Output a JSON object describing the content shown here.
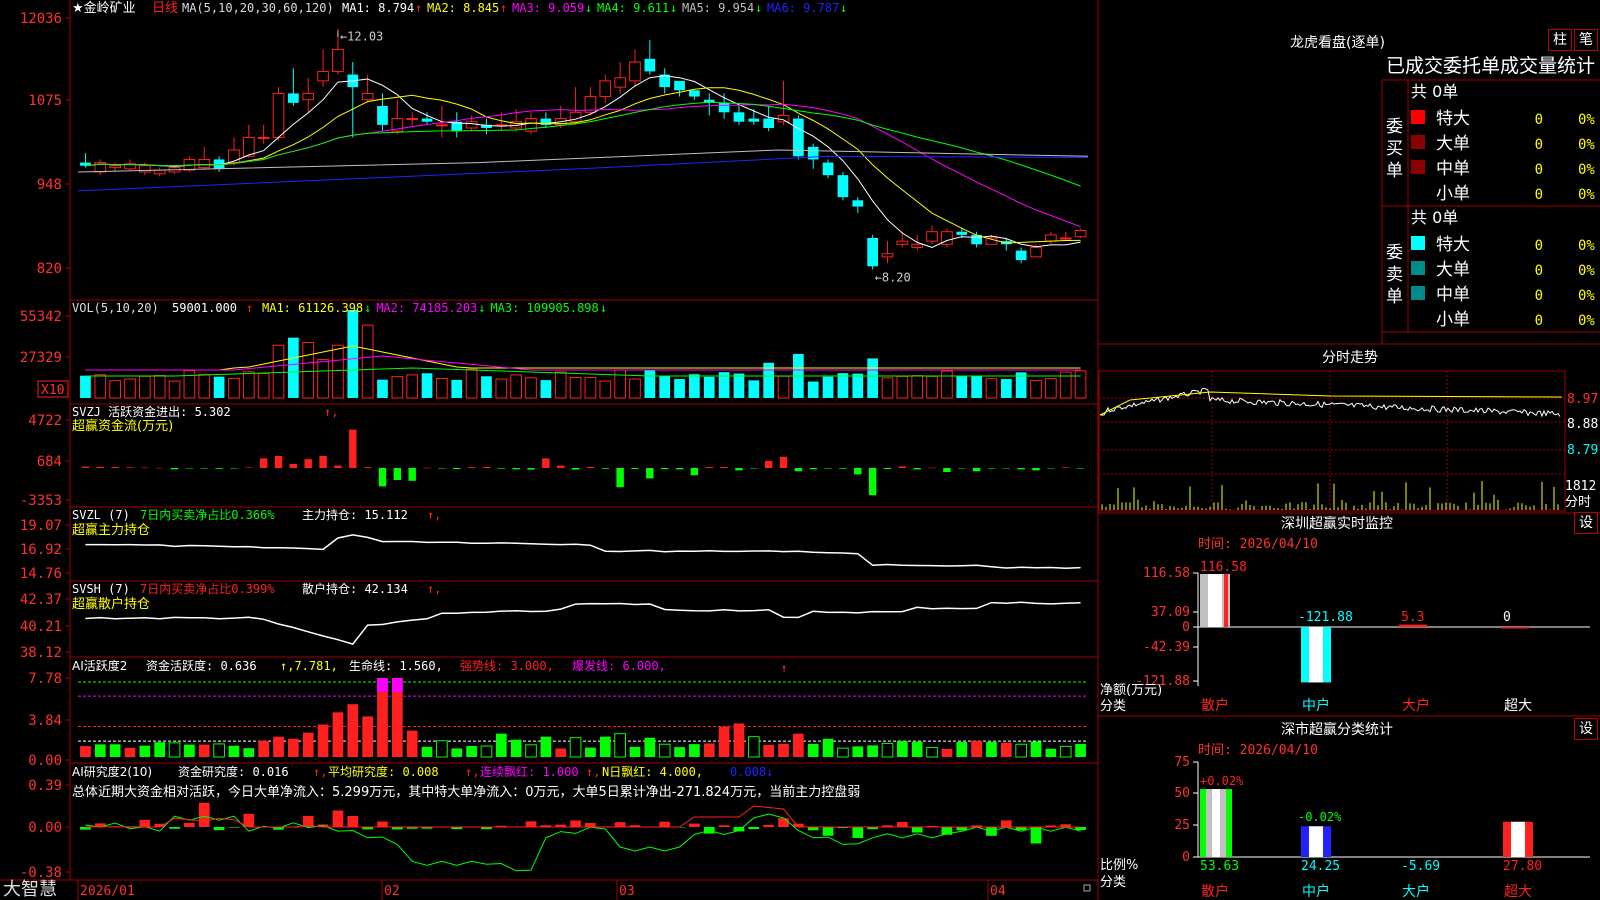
{
  "colors": {
    "up": "#ff2020",
    "down": "#00ffff",
    "grid": "#a00000",
    "axisText": "#ff3030",
    "white": "#ffffff",
    "ma1": "#ffffff",
    "ma2": "#ffff00",
    "ma3": "#ff00ff",
    "ma4": "#00ff00",
    "ma5": "#c0c0c0",
    "ma6": "#2222ff"
  },
  "stock": {
    "name": "金岭矿业",
    "period": "日线",
    "star": "★"
  },
  "price_panel": {
    "ma_label": "MA(5,10,20,30,60,120)",
    "ma": [
      {
        "label": "MA1:",
        "value": "8.794",
        "arrow": "↑",
        "color": "#ffffff"
      },
      {
        "label": "MA2:",
        "value": "8.845",
        "arrow": "↑",
        "color": "#ffff00"
      },
      {
        "label": "MA3:",
        "value": "9.059",
        "arrow": "↓",
        "color": "#ff00ff"
      },
      {
        "label": "MA4:",
        "value": "9.611",
        "arrow": "↓",
        "color": "#00ff00"
      },
      {
        "label": "MA5:",
        "value": "9.954",
        "arrow": "↓",
        "color": "#c0c0c0"
      },
      {
        "label": "MA6:",
        "value": "9.787",
        "arrow": "↓",
        "color": "#2222ff"
      }
    ],
    "y_ticks": [
      "12036",
      "1075",
      "948",
      "820"
    ],
    "high_label": "12.03",
    "low_label": "8.20"
  },
  "vol_panel": {
    "title": "VOL(5,10,20)",
    "value": "59001.000",
    "arrow": "↑",
    "ma": [
      {
        "label": "MA1:",
        "value": "61126.398",
        "arrow": "↓",
        "color": "#ffff00"
      },
      {
        "label": "MA2:",
        "value": "74185.203",
        "arrow": "↓",
        "color": "#ff00ff"
      },
      {
        "label": "MA3:",
        "value": "109905.898",
        "arrow": "↓",
        "color": "#00ff00"
      }
    ],
    "y_ticks": [
      "55342",
      "27329"
    ],
    "unit": "X10"
  },
  "svzj_panel": {
    "title": "SVZJ",
    "desc": "活跃资金进出:",
    "value": "5.302",
    "arrow": "↑",
    "subtitle": "超赢资金流(万元)",
    "y_ticks": [
      "4722",
      "684",
      "-3353"
    ]
  },
  "svzl_panel": {
    "title": "SVZL (7)",
    "desc": "7日内买卖净占比0.366%",
    "desc2": "主力持仓:",
    "value": "15.112",
    "arrow": "↑",
    "subtitle": "超赢主力持仓",
    "y_ticks": [
      "19.07",
      "16.92",
      "14.76"
    ]
  },
  "svsh_panel": {
    "title": "SVSH (7)",
    "desc": "7日内买卖净占比0.399%",
    "desc2": "散户持仓:",
    "value": "42.134",
    "arrow": "↑",
    "subtitle": "超赢散户持仓",
    "y_ticks": [
      "42.37",
      "40.21",
      "38.12"
    ]
  },
  "ai_act_panel": {
    "title": "AI活跃度2",
    "desc": "资金活跃度:",
    "value": "0.636",
    "v2": "7.781",
    "life": "生命线:",
    "life_v": "1.560",
    "strong": "强势线:",
    "strong_v": "3.000",
    "burst": "爆发线:",
    "burst_v": "6.000",
    "y_ticks": [
      "7.78",
      "3.84",
      "0.00"
    ]
  },
  "ai_res_panel": {
    "title": "AI研究度2(10)",
    "desc": "资金研究度:",
    "value": "0.016",
    "avg": "平均研究度:",
    "avg_v": "0.008",
    "lx": "连续飘红:",
    "lx_v": "1.000",
    "nr": "N日飘红:",
    "nr_v": "4.000",
    "nr_v2": "0.008",
    "summary": "总体近期大资金相对活跃，今日大单净流入：5.299万元，其中特大单净流入：0万元，大单5日累计净出-271.824万元，当前主力控盘弱",
    "y_ticks": [
      "0.39",
      "0.00",
      "-0.38"
    ]
  },
  "bottom": {
    "logo": "大智慧",
    "dates": [
      "2026/01",
      "02",
      "03",
      "04"
    ]
  },
  "lhb": {
    "title": "龙虎看盘(逐单)",
    "btn1": "柱",
    "btn2": "笔",
    "header": "已成交委托单成交量统计",
    "buy": {
      "label": "委买单",
      "total": "共 0单",
      "rows": [
        {
          "name": "特大",
          "v": "0",
          "p": "0%",
          "c": "#ff0000"
        },
        {
          "name": "大单",
          "v": "0",
          "p": "0%",
          "c": "#8b0000"
        },
        {
          "name": "中单",
          "v": "0",
          "p": "0%",
          "c": "#8b0000"
        },
        {
          "name": "小单",
          "v": "0",
          "p": "0%",
          "c": "#000000"
        }
      ]
    },
    "sell": {
      "label": "委卖单",
      "total": "共 0单",
      "rows": [
        {
          "name": "特大",
          "v": "0",
          "p": "0%",
          "c": "#00ffff"
        },
        {
          "name": "大单",
          "v": "0",
          "p": "0%",
          "c": "#008b8b"
        },
        {
          "name": "中单",
          "v": "0",
          "p": "0%",
          "c": "#008b8b"
        },
        {
          "name": "小单",
          "v": "0",
          "p": "0%",
          "c": "#000000"
        }
      ]
    }
  },
  "fenshi": {
    "title": "分时走势",
    "p1": "8.97",
    "p2": "8.88",
    "p3": "8.79",
    "vol": "1812",
    "unit": "分时"
  },
  "sz_monitor": {
    "title": "深圳超赢实时监控",
    "btn": "设",
    "time": "时间: 2026/04/10",
    "y_ticks": [
      "116.58",
      "37.09",
      "0",
      "-42.39",
      "-121.88"
    ],
    "labels": [
      "116.58",
      "-121.88",
      "5.3",
      "0"
    ],
    "cats": [
      "散户",
      "中户",
      "大户",
      "超大"
    ],
    "ylabel": "净额(万元)",
    "xlabel": "分类"
  },
  "sz_class": {
    "title": "深市超赢分类统计",
    "btn": "设",
    "time": "时间: 2026/04/10",
    "y_ticks": [
      "75",
      "50",
      "25",
      "0"
    ],
    "top_labels": [
      "+0.02%",
      "-0.02%"
    ],
    "values": [
      "53.63",
      "24.25",
      "-5.69",
      "27.80"
    ],
    "cats": [
      "散户",
      "中户",
      "大户",
      "超大"
    ],
    "ylabel": "比例%",
    "xlabel": "分类"
  },
  "chart_data": [
    {
      "type": "candlestick",
      "title": "金岭矿业 日线",
      "ylim": [
        8.0,
        12.2
      ],
      "ohlc": [
        [
          9.9,
          9.85,
          10.05,
          9.82
        ],
        [
          9.75,
          9.9,
          9.95,
          9.7
        ],
        [
          9.82,
          9.85,
          9.9,
          9.75
        ],
        [
          9.8,
          9.88,
          9.95,
          9.78
        ],
        [
          9.75,
          9.85,
          9.9,
          9.7
        ],
        [
          9.72,
          9.78,
          9.82,
          9.68
        ],
        [
          9.75,
          9.82,
          9.85,
          9.72
        ],
        [
          9.78,
          9.95,
          10.0,
          9.75
        ],
        [
          9.82,
          9.95,
          10.15,
          9.8
        ],
        [
          9.95,
          9.8,
          10.0,
          9.75
        ],
        [
          9.9,
          10.1,
          10.3,
          9.85
        ],
        [
          10.0,
          10.3,
          10.5,
          9.98
        ],
        [
          10.3,
          10.3,
          10.5,
          10.2
        ],
        [
          10.3,
          11.0,
          11.1,
          10.25
        ],
        [
          11.0,
          10.85,
          11.4,
          10.8
        ],
        [
          10.9,
          11.0,
          11.25,
          10.7
        ],
        [
          11.2,
          11.35,
          11.7,
          11.1
        ],
        [
          11.35,
          11.7,
          12.03,
          11.3
        ],
        [
          11.3,
          11.1,
          11.5,
          10.3
        ],
        [
          10.9,
          11.0,
          11.3,
          10.85
        ],
        [
          10.8,
          10.5,
          11.0,
          10.4
        ],
        [
          10.4,
          10.6,
          10.9,
          10.35
        ],
        [
          10.6,
          10.6,
          10.7,
          10.5
        ],
        [
          10.6,
          10.55,
          10.7,
          10.5
        ],
        [
          10.5,
          10.5,
          10.8,
          10.3
        ],
        [
          10.55,
          10.4,
          10.7,
          10.3
        ],
        [
          10.45,
          10.55,
          10.65,
          10.4
        ],
        [
          10.5,
          10.45,
          10.6,
          10.35
        ],
        [
          10.5,
          10.5,
          10.7,
          10.4
        ],
        [
          10.45,
          10.55,
          10.75,
          10.4
        ],
        [
          10.4,
          10.6,
          10.7,
          10.35
        ],
        [
          10.6,
          10.5,
          10.7,
          10.45
        ],
        [
          10.5,
          10.6,
          10.8,
          10.45
        ],
        [
          10.55,
          10.7,
          11.1,
          10.5
        ],
        [
          10.7,
          10.95,
          11.1,
          10.65
        ],
        [
          10.95,
          11.2,
          11.3,
          10.85
        ],
        [
          11.1,
          11.25,
          11.5,
          11.0
        ],
        [
          11.2,
          11.5,
          11.7,
          11.1
        ],
        [
          11.55,
          11.35,
          11.85,
          11.3
        ],
        [
          11.3,
          11.1,
          11.4,
          11.0
        ],
        [
          11.2,
          11.05,
          11.2,
          10.95
        ],
        [
          11.05,
          10.95,
          11.05,
          10.9
        ],
        [
          10.9,
          10.85,
          11.0,
          10.65
        ],
        [
          10.85,
          10.7,
          11.0,
          10.6
        ],
        [
          10.7,
          10.55,
          10.85,
          10.5
        ],
        [
          10.6,
          10.55,
          10.75,
          10.5
        ],
        [
          10.6,
          10.45,
          10.8,
          10.4
        ],
        [
          10.55,
          10.65,
          11.2,
          10.5
        ],
        [
          10.6,
          10.0,
          10.65,
          9.95
        ],
        [
          10.15,
          9.95,
          10.2,
          9.8
        ],
        [
          9.9,
          9.7,
          9.95,
          9.65
        ],
        [
          9.7,
          9.35,
          9.75,
          9.3
        ],
        [
          9.3,
          9.2,
          9.35,
          9.1
        ],
        [
          8.7,
          8.25,
          8.75,
          8.2
        ],
        [
          8.4,
          8.45,
          8.65,
          8.3
        ],
        [
          8.6,
          8.65,
          8.8,
          8.55
        ],
        [
          8.55,
          8.6,
          8.75,
          8.5
        ],
        [
          8.65,
          8.8,
          8.9,
          8.6
        ],
        [
          8.6,
          8.8,
          8.85,
          8.55
        ],
        [
          8.8,
          8.75,
          8.85,
          8.7
        ],
        [
          8.75,
          8.6,
          8.8,
          8.55
        ],
        [
          8.6,
          8.7,
          8.75,
          8.6
        ],
        [
          8.65,
          8.6,
          8.7,
          8.5
        ],
        [
          8.5,
          8.35,
          8.55,
          8.3
        ],
        [
          8.4,
          8.55,
          8.6,
          8.4
        ],
        [
          8.65,
          8.75,
          8.8,
          8.6
        ],
        [
          8.7,
          8.7,
          8.8,
          8.65
        ],
        [
          8.72,
          8.82,
          8.85,
          8.7
        ]
      ]
    }
  ]
}
